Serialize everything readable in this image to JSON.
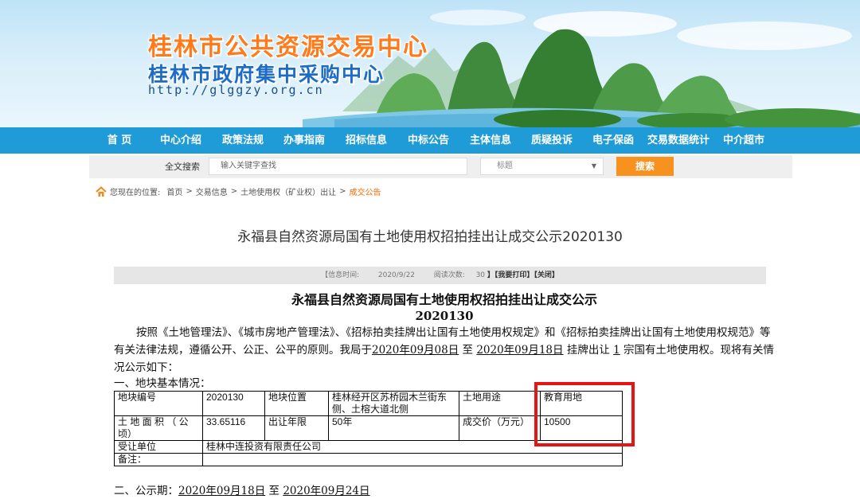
{
  "banner": {
    "title_main": "桂林市公共资源交易中心",
    "title_sub": "桂林市政府集中采购中心",
    "url": "http://glggzy.org.cn"
  },
  "nav": {
    "items": [
      "首 页",
      "中心介绍",
      "政策法规",
      "办事指南",
      "招标信息",
      "中标公告",
      "主体信息",
      "质疑投诉",
      "电子保函",
      "交易数据统计",
      "中介超市"
    ]
  },
  "search": {
    "label": "全文搜索",
    "placeholder": "输入关键字查找",
    "select_value": "标题",
    "button": "搜索"
  },
  "breadcrumb": {
    "prefix": "您现在的位置:",
    "items": [
      "首页",
      "交易信息",
      "土地使用权（矿业权）出让"
    ],
    "current": "成交公告"
  },
  "page_title": "永福县自然资源局国有土地使用权招拍挂出让成交公示2020130",
  "info_bar": {
    "time_label": "【信息时间:",
    "time_value": "2020/9/22",
    "views_label": "阅读次数:",
    "views_value": "30",
    "actions": "】【我要打印】【关闭】"
  },
  "article": {
    "heading1": "永福县自然资源局国有土地使用权招拍挂出让成交公示",
    "heading2": "2020130",
    "para_a": "按照《土地管理法》、《城市房地产管理法》、《招标拍卖挂牌出让国有土地使用权规定》和《招标拍卖挂牌出让国有土地使用权规范》等有关法律法规，遵循公开、公正、公平的原则。我局于",
    "date_start": "2020年09月08日",
    "para_b": " 至 ",
    "date_end": "2020年09月18日",
    "para_c": " 挂牌出让 ",
    "count": "1",
    "para_d": " 宗国有土地使用权。现将有关情况公示如下：",
    "section1": "一、地块基本情况："
  },
  "table": {
    "r1": [
      "地块编号",
      "2020130",
      "地块位置",
      "桂林经开区苏桥园木兰街东侧、土榕大道北侧",
      "土地用途",
      "教育用地"
    ],
    "r2": [
      "土 地 面 积 （ 公 顷）",
      "33.65116",
      "出让年限",
      "50年",
      "成交价（万元）",
      "10500"
    ],
    "r3": [
      "受让单位",
      "桂林中连投资有限责任公司"
    ],
    "r4": [
      "备注：",
      ""
    ]
  },
  "period": {
    "label": "二、公示期：",
    "start": "2020年09月18日",
    "mid": " 至 ",
    "end": "2020年09月24日"
  },
  "colors": {
    "nav_bg": "#1f9bd8",
    "search_btn": "#f7921e",
    "breadcrumb_current": "#ff6600",
    "title_orange": "#ff7a1a",
    "highlight_red": "#e51515"
  }
}
